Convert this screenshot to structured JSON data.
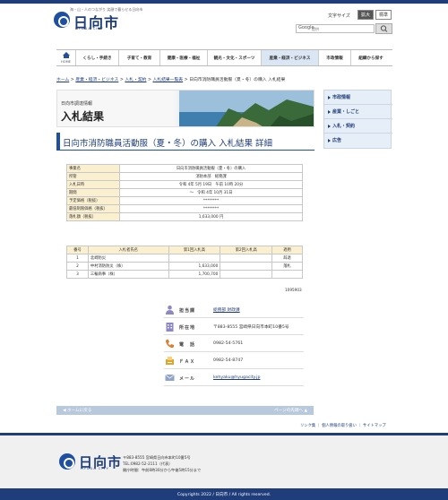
{
  "header": {
    "tagline": "海・山・人のつながり 笑顔で暮らせる日向市",
    "logo_name": "日向市",
    "logo_sub": "HYUGA CITY",
    "font_size_label": "文字サイズ",
    "font_size_large": "拡大",
    "font_size_standard": "標準",
    "search_brand": "Google",
    "search_placeholder": "提供"
  },
  "nav": {
    "home_label": "HOME",
    "items": [
      {
        "label": "くらし・手続き"
      },
      {
        "label": "子育て・教育"
      },
      {
        "label": "健康・医療・福祉"
      },
      {
        "label": "観光・文化・スポーツ"
      },
      {
        "label": "産業・経済・ビジネス"
      },
      {
        "label": "市政情報"
      },
      {
        "label": "組織から探す"
      }
    ]
  },
  "breadcrumb": {
    "items": [
      "ホーム",
      "産業・経済・ビジネス",
      "入札・契約",
      "入札結果一覧表"
    ],
    "separator": ">",
    "current": "日向市消防職員活動服（夏・冬）の購入 入札結果"
  },
  "hero": {
    "small": "日向市調達情報",
    "big": "入札結果"
  },
  "side_menu": {
    "items": [
      "市政情報",
      "産業・しごと",
      "入札・契約",
      "広告"
    ]
  },
  "page_title": "日向市消防職員活動服（夏・冬）の購入 入札結果 詳細",
  "info_table": [
    {
      "label": "事業名",
      "value": "日向市消防職員活動服（夏・冬）の購入"
    },
    {
      "label": "所管",
      "value": "消防本部　総務課"
    },
    {
      "label": "入札日時",
      "value": "令和 4年 5月 19日　午前 10時 20分"
    },
    {
      "label": "期間",
      "value": "〜　令和 4年 10月 31日"
    },
    {
      "label": "予定価格（税抜）",
      "value": "********"
    },
    {
      "label": "最低制限価格（税抜）",
      "value": "********"
    },
    {
      "label": "落札額（税抜）",
      "value": "1,633,000 円"
    }
  ],
  "bid_table": {
    "headers": [
      "番号",
      "入札者氏名",
      "第1回入札高",
      "第2回入札高",
      "適用"
    ],
    "rows": [
      [
        "1",
        "北崎防災",
        "",
        "",
        "辞退"
      ],
      [
        "2",
        "中村消防防災（株）",
        "1,633,000",
        "",
        "落札"
      ],
      [
        "3",
        "三輪商事（株）",
        "1,700,700",
        "",
        ""
      ]
    ]
  },
  "note": "1095903",
  "contact": {
    "dept_label": "担当課",
    "dept_value": "総務部 財政課",
    "addr_label": "所在地",
    "addr_value": "〒883-8555 宮崎県日向市本町10番5号",
    "tel_label": "電　話",
    "tel_value": "0982-54-5761",
    "fax_label": "ＦＡＸ",
    "fax_value": "0982-54-8747",
    "mail_label": "メール",
    "mail_value": "kehyaku@hyugacity.jp"
  },
  "footer_nav": {
    "prev": "ホームに戻る",
    "next": "ページの先頭へ"
  },
  "footer_links": "リンク集 ｜ 個人情報の取り扱い ｜ サイトマップ",
  "footer": {
    "logo_name": "日向市",
    "logo_sub": "HYUGA CITY",
    "address": "〒883-8555 宮崎県日向市本町10番5号",
    "tel": "TEL:0982-52-2111（代表）",
    "hours": "開庁時間：午前8時30分から午後5時15分まで",
    "copyright": "Copyrights 2022 / 日向市 / All rights reserved."
  },
  "colors": {
    "brand": "#1f3d7a",
    "accent": "#1f4fa0",
    "label_bg": "#faefcf"
  }
}
